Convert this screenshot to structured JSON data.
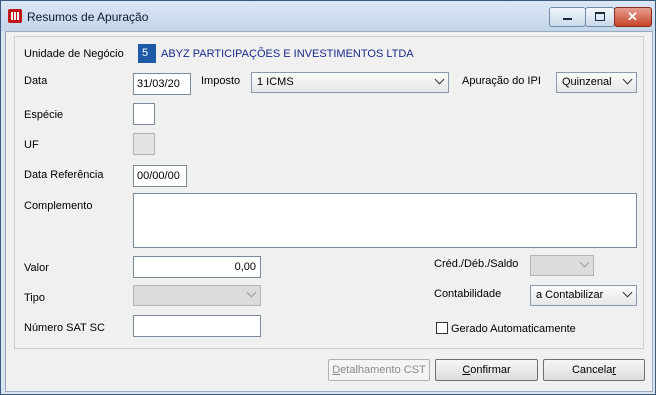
{
  "window": {
    "title": "Resumos de Apuração"
  },
  "form": {
    "unidade": {
      "label": "Unidade de Negócio",
      "code": "5",
      "name": "ABYZ PARTICIPAÇÕES E INVESTIMENTOS LTDA"
    },
    "data": {
      "label": "Data",
      "value": "31/03/20"
    },
    "imposto": {
      "label": "Imposto",
      "value": "1 ICMS"
    },
    "apuracao_ipi": {
      "label": "Apuração do IPI",
      "value": "Quinzenal"
    },
    "especie": {
      "label": "Espécie",
      "value": ""
    },
    "uf": {
      "label": "UF",
      "value": ""
    },
    "data_referencia": {
      "label": "Data Referência",
      "value": "00/00/00"
    },
    "complemento": {
      "label": "Complemento",
      "value": ""
    },
    "valor": {
      "label": "Valor",
      "value": "0,00"
    },
    "cred_deb_saldo": {
      "label": "Créd./Déb./Saldo",
      "value": ""
    },
    "tipo": {
      "label": "Tipo",
      "value": ""
    },
    "contabilidade": {
      "label": "Contabilidade",
      "value": "a Contabilizar"
    },
    "numero_sat": {
      "label": "Número SAT SC",
      "value": ""
    },
    "gerado": {
      "label": "Gerado Automaticamente",
      "checked": false
    }
  },
  "buttons": {
    "detalhamento": {
      "first": "D",
      "rest": "etalhamento CST"
    },
    "confirmar": {
      "first": "C",
      "rest": "onfirmar"
    },
    "cancelar": {
      "first": "Cancela",
      "underline": "r"
    }
  }
}
